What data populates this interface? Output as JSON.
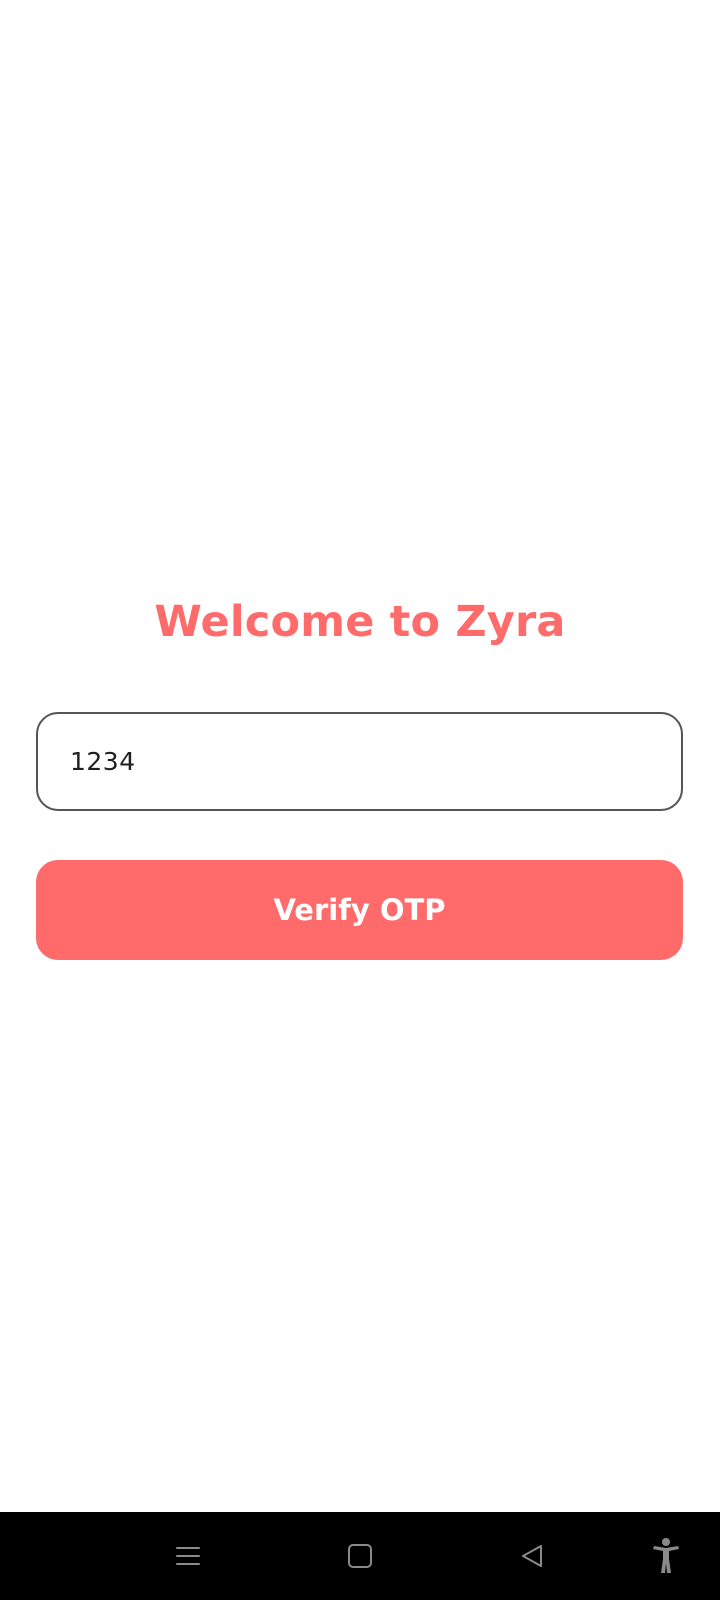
{
  "welcome": {
    "title": "Welcome to Zyra"
  },
  "otp": {
    "value": "1234"
  },
  "actions": {
    "verify_label": "Verify OTP"
  },
  "colors": {
    "accent": "#FF6B6B",
    "nav_background": "#000000",
    "nav_icon": "#8a8a8a"
  },
  "navigation": {
    "icons": [
      "menu-icon",
      "home-icon",
      "back-icon",
      "accessibility-icon"
    ]
  }
}
